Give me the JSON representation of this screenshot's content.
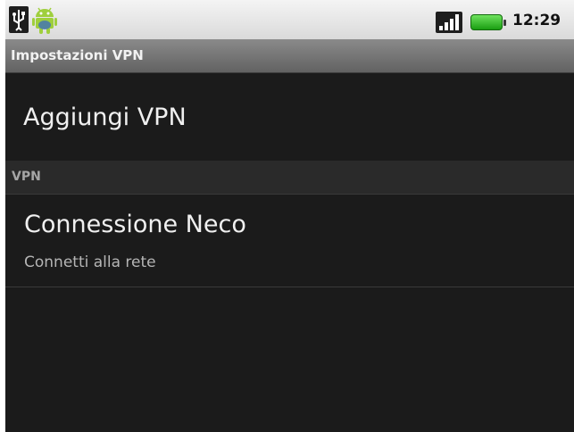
{
  "status_bar": {
    "clock": "12:29",
    "icons": [
      "usb-icon",
      "android-debug-icon",
      "signal-icon",
      "battery-icon"
    ],
    "battery_color": "#2bbf1d"
  },
  "title_bar": {
    "title": "Impostazioni VPN"
  },
  "preferences": {
    "add_vpn_label": "Aggiungi VPN",
    "section_header": "VPN",
    "vpn_entries": [
      {
        "name": "Connessione Neco",
        "summary": "Connetti alla rete"
      }
    ]
  }
}
